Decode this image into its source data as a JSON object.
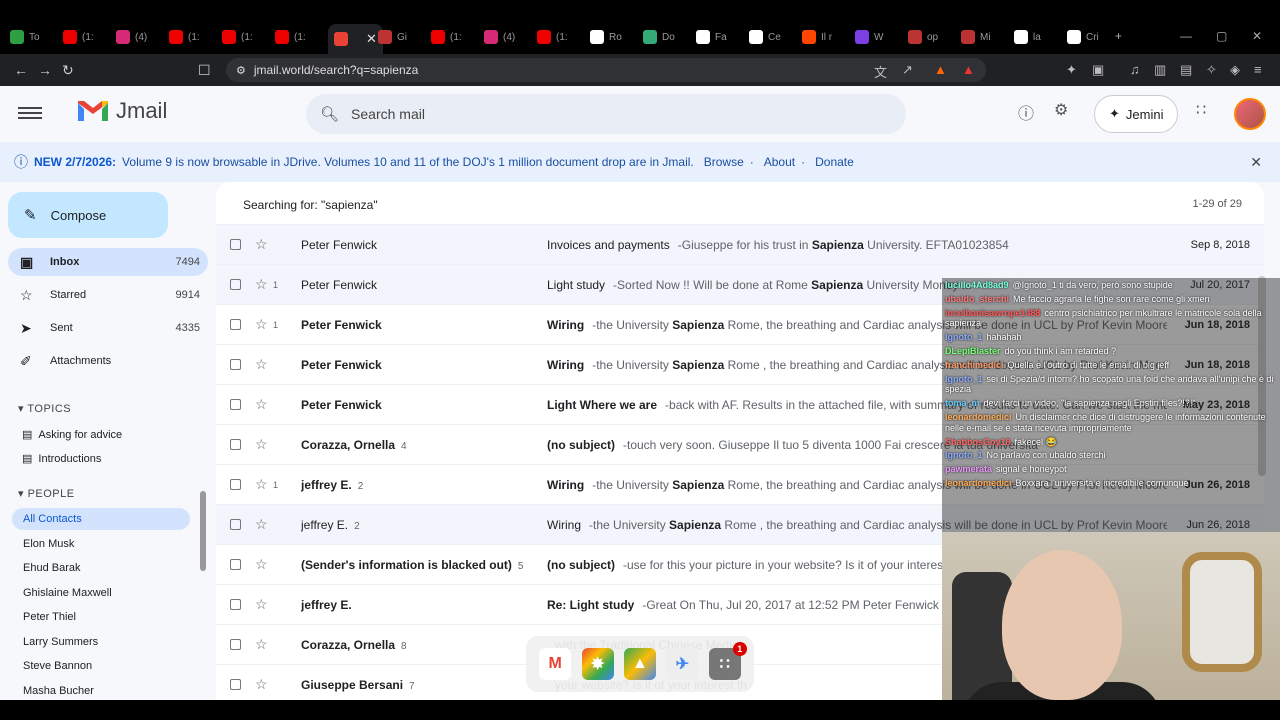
{
  "browser": {
    "tabs": [
      {
        "label": "To",
        "color": "#2ea043"
      },
      {
        "label": "(1:",
        "color": "#e00"
      },
      {
        "label": "(4)",
        "color": "#d62976"
      },
      {
        "label": "(1:",
        "color": "#e00"
      },
      {
        "label": "(1:",
        "color": "#e00"
      },
      {
        "label": "(1:",
        "color": "#e00"
      },
      {
        "label": "",
        "color": "#ea4335",
        "active": true
      },
      {
        "label": "Gi",
        "color": "#b33"
      },
      {
        "label": "(1:",
        "color": "#e00"
      },
      {
        "label": "(4)",
        "color": "#d62976"
      },
      {
        "label": "(1:",
        "color": "#e00"
      },
      {
        "label": "Ro",
        "color": "#fff"
      },
      {
        "label": "Do",
        "color": "#3a7"
      },
      {
        "label": "Fa",
        "color": "#fff"
      },
      {
        "label": "Ce",
        "color": "#fff"
      },
      {
        "label": "Il r",
        "color": "#ff4500"
      },
      {
        "label": "W",
        "color": "#7b3fe4"
      },
      {
        "label": "op",
        "color": "#b33"
      },
      {
        "label": "Mi",
        "color": "#b33"
      },
      {
        "label": "la",
        "color": "#fff"
      },
      {
        "label": "Cri",
        "color": "#fff"
      }
    ],
    "url": "jmail.world/search?q=sapienza"
  },
  "app": {
    "logo_text": "Jmail",
    "search_placeholder": "Search mail",
    "jemini_label": "Jemini"
  },
  "banner": {
    "headline": "NEW 2/7/2026:",
    "text": "Volume 9 is now browsable in JDrive. Volumes 10 and 11 of the DOJ's 1 million document drop are in Jmail.",
    "browse": "Browse",
    "about": "About",
    "donate": "Donate"
  },
  "sidebar": {
    "compose": "Compose",
    "items": [
      {
        "label": "Inbox",
        "count": "7494"
      },
      {
        "label": "Starred",
        "count": "9914"
      },
      {
        "label": "Sent",
        "count": "4335"
      },
      {
        "label": "Attachments",
        "count": ""
      }
    ],
    "topics_title": "TOPICS",
    "topics": [
      "Asking for advice",
      "Introductions"
    ],
    "people_title": "PEOPLE",
    "people": [
      "All Contacts",
      "Elon Musk",
      "Ehud Barak",
      "Ghislaine Maxwell",
      "Peter Thiel",
      "Larry Summers",
      "Steve Bannon",
      "Masha Bucher"
    ]
  },
  "main": {
    "search_header": "Searching for: \"sapienza\"",
    "pager": "1-29 of 29",
    "rows": [
      {
        "sender": "Peter Fenwick",
        "n": "",
        "imp": "",
        "subject": "Invoices and payments",
        "snip_pre": "-Giuseppe for his trust in ",
        "hl": "Sapienza",
        "snip_post": " University. EFTA01023854",
        "date": "Sep 8, 2018",
        "unread": false
      },
      {
        "sender": "Peter Fenwick",
        "n": "",
        "imp": "1",
        "subject": "Light study",
        "snip_pre": "-Sorted Now !! Will be done at Rome ",
        "hl": "Sapienza",
        "snip_post": " University Money ...",
        "date": "Jul 20, 2017",
        "unread": false
      },
      {
        "sender": "Peter Fenwick",
        "n": "",
        "imp": "1",
        "subject": "Wiring",
        "snip_pre": "-the University ",
        "hl": "Sapienza",
        "snip_post": " Rome, the breathing and Cardiac analysis will be done in UCL by Prof Kevin Moore, and",
        "date": "Jun 18, 2018",
        "unread": true
      },
      {
        "sender": "Peter Fenwick",
        "n": "",
        "imp": "",
        "subject": "Wiring",
        "snip_pre": "-the University ",
        "hl": "Sapienza",
        "snip_post": " Rome , the breathing and Cardiac analysis will be done in UCL by Prof Kevin Moore, an",
        "date": "Jun 18, 2018",
        "unread": true
      },
      {
        "sender": "Peter Fenwick",
        "n": "",
        "imp": "",
        "subject": "Light Where we are",
        "snip_pre": "-back with AF. Results in the attached file, with summary of results to date. Can we start the main",
        "hl": "",
        "snip_post": "",
        "date": "May 23, 2018",
        "unread": true
      },
      {
        "sender": "Corazza, Ornella",
        "n": "4",
        "imp": "",
        "subject": "(no subject)",
        "snip_pre": "-touch very soon. Giuseppe Il tuo 5 diventa 1000 Fai crescere la tua università ",
        "hl": "",
        "snip_post": "",
        "date": "",
        "unread": true
      },
      {
        "sender": "jeffrey E.",
        "n": "2",
        "imp": "1",
        "subject": "Wiring",
        "snip_pre": "-the University ",
        "hl": "Sapienza",
        "snip_post": " Rome, the breathing and Cardiac analysis will be done in UCL by Prof Kevin Moore, and",
        "date": "Jun 26, 2018",
        "unread": true
      },
      {
        "sender": "jeffrey E.",
        "n": "2",
        "imp": "",
        "subject": "Wiring",
        "snip_pre": "-the University ",
        "hl": "Sapienza",
        "snip_post": " Rome , the breathing and Cardiac analysis will be done in UCL by Prof Kevin Moore, an",
        "date": "Jun 26, 2018",
        "unread": false
      },
      {
        "sender": "(Sender's information is blacked out)",
        "n": "5",
        "imp": "",
        "subject": "(no subject)",
        "snip_pre": "-use for this your picture in your website? Is it of your interest th",
        "hl": "",
        "snip_post": "",
        "date": "",
        "unread": true
      },
      {
        "sender": "jeffrey E.",
        "n": "",
        "imp": "",
        "subject": "Re: Light study",
        "snip_pre": "-Great On Thu, Jul 20, 2017 at 12:52 PM Peter Fenwick < > w",
        "hl": "",
        "snip_post": "",
        "date": "",
        "unread": true
      },
      {
        "sender": "Corazza, Ornella",
        "n": "8",
        "imp": "",
        "subject": "",
        "snip_pre": "with the Traditional Chinese Medicin",
        "hl": "",
        "snip_post": "",
        "date": "",
        "unread": true
      },
      {
        "sender": "Giuseppe Bersani",
        "n": "7",
        "imp": "",
        "subject": "",
        "snip_pre": "your website? Is it of your interest th",
        "hl": "",
        "snip_post": "",
        "date": "",
        "unread": true
      }
    ]
  },
  "chat": [
    {
      "user": "lucillo4Ad8ad9",
      "color": "#7fd",
      "text": "@Ignoto_1 ti da vero, però sono stupide"
    },
    {
      "user": "ubaldo_sterchi",
      "color": "#f77",
      "text": "Me faccio agrarla le fighe son rare come gli xmen"
    },
    {
      "user": "incelbanisawrope1488",
      "color": "#f55",
      "text": "centro psichiatrico per mkultrare le matricole sola della sapienza"
    },
    {
      "user": "Ignoto_1",
      "color": "#8af",
      "text": "hahahah"
    },
    {
      "user": "DLepiBlaster",
      "color": "#7f7",
      "text": "do you think i am retarded ?"
    },
    {
      "user": "franchimedici",
      "color": "#f96",
      "text": "Quella è l'outro di tutte le email di big jeff"
    },
    {
      "user": "Ignoto_1",
      "color": "#8af",
      "text": "sei di Spezia/d intorni? ho scopato una foid che andava all'unipi che è di spezia"
    },
    {
      "user": "toma_m",
      "color": "#6cf",
      "text": "devi farci un video, \"la sapienza negli Epstin files?!?!\""
    },
    {
      "user": "leonardomedici",
      "color": "#fa5",
      "text": "Un disclaimer che dice di distruggere le informazioni contenute nelle e-mail se è stata ricevuta impropriamente"
    },
    {
      "user": "ShabbosGoy18",
      "color": "#f66",
      "text": "fakecel 😂"
    },
    {
      "user": "Ignoto_1",
      "color": "#8af",
      "text": "No parlavo con ubaldo sterchi"
    },
    {
      "user": "pawmerata",
      "color": "#e9f",
      "text": "signal e honeypot"
    },
    {
      "user": "leonardomedici",
      "color": "#fa5",
      "text": "Boxxara l'università è incredibile comunque"
    }
  ]
}
